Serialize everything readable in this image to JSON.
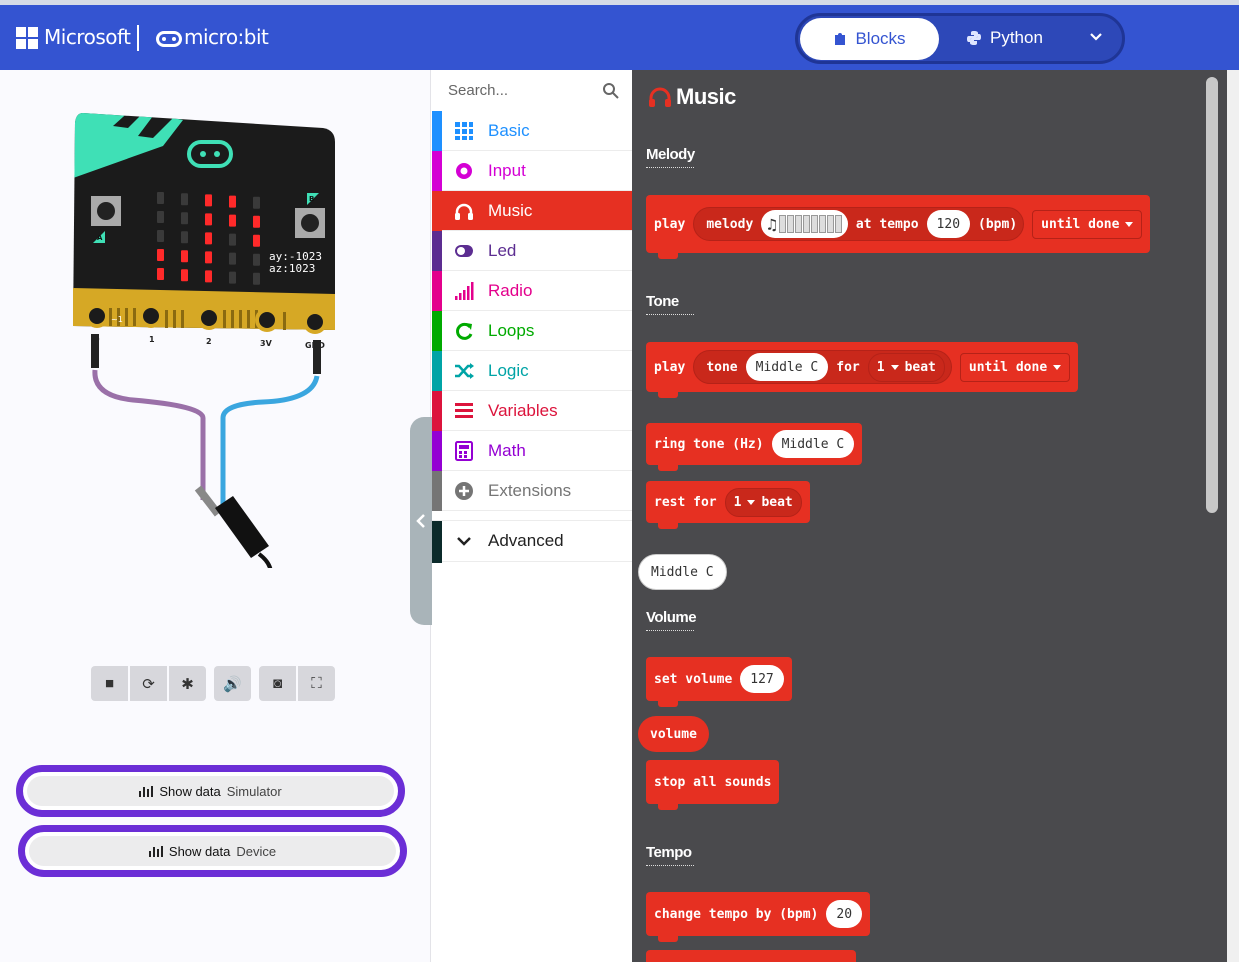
{
  "header": {
    "brand": "Microsoft",
    "product": "micro:bit",
    "mode_blocks": "Blocks",
    "mode_python": "Python",
    "colors": {
      "header": "#3454d1",
      "accent_purple": "#6b2ed6"
    }
  },
  "simulator": {
    "readout_ay": "ay:-1023",
    "readout_az": "az:1023",
    "pins": [
      "0",
      "1",
      "2",
      "3V",
      "GND"
    ],
    "pin_small": "~1",
    "button_a": "A",
    "button_b": "B",
    "controls": [
      "stop-icon",
      "restart-icon",
      "debug-icon",
      "mute-icon",
      "screenshot-icon",
      "fullscreen-icon"
    ],
    "show_data_simulator": {
      "label": "Show data",
      "source": "Simulator"
    },
    "show_data_device": {
      "label": "Show data",
      "source": "Device"
    }
  },
  "toolbox": {
    "search_placeholder": "Search...",
    "categories": [
      {
        "label": "Basic",
        "color": "#1e90ff",
        "icon": "grid-icon"
      },
      {
        "label": "Input",
        "color": "#d400d4",
        "icon": "circle-dot-icon"
      },
      {
        "label": "Music",
        "color": "#e63022",
        "icon": "headphones-icon"
      },
      {
        "label": "Led",
        "color": "#5c2d91",
        "icon": "toggle-icon"
      },
      {
        "label": "Radio",
        "color": "#e3008c",
        "icon": "signal-bars-icon"
      },
      {
        "label": "Loops",
        "color": "#00aa00",
        "icon": "loop-arrow-icon"
      },
      {
        "label": "Logic",
        "color": "#00a4a6",
        "icon": "shuffle-icon"
      },
      {
        "label": "Variables",
        "color": "#dc143c",
        "icon": "lines-icon"
      },
      {
        "label": "Math",
        "color": "#9400d3",
        "icon": "calculator-icon"
      },
      {
        "label": "Extensions",
        "color": "#757575",
        "icon": "plus-circle-icon"
      }
    ],
    "advanced": "Advanced"
  },
  "flyout": {
    "title": "Music",
    "sections": {
      "melody": "Melody",
      "tone": "Tone",
      "volume": "Volume",
      "tempo": "Tempo"
    },
    "blocks": {
      "play_melody": {
        "play": "play",
        "melody": "melody",
        "at_tempo": "at tempo",
        "tempo": "120",
        "bpm": "(bpm)",
        "until": "until done"
      },
      "play_tone": {
        "play": "play",
        "tone": "tone",
        "note": "Middle C",
        "for": "for",
        "beats": "1",
        "beat": "beat",
        "until": "until done"
      },
      "ring_tone": {
        "text": "ring tone (Hz)",
        "note": "Middle C"
      },
      "rest": {
        "text": "rest for",
        "beats": "1",
        "beat": "beat"
      },
      "note_reporter": "Middle C",
      "set_volume": {
        "text": "set volume",
        "value": "127"
      },
      "volume_reporter": "volume",
      "stop_all": "stop all sounds",
      "change_tempo": {
        "text": "change tempo by (bpm)",
        "value": "20"
      }
    }
  }
}
